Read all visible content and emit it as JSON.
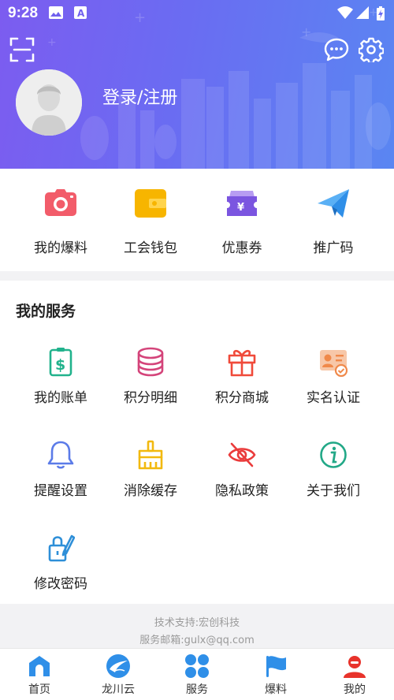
{
  "status_bar": {
    "time": "9:28"
  },
  "header": {
    "login_label": "登录/注册",
    "scan_icon": "scan-icon",
    "message_icon": "chat-bubble-icon",
    "settings_icon": "gear-icon"
  },
  "quick_actions": [
    {
      "label": "我的爆料",
      "icon": "camera-icon",
      "color": "#f25c6a"
    },
    {
      "label": "工会钱包",
      "icon": "wallet-icon",
      "color": "#f7b500"
    },
    {
      "label": "优惠券",
      "icon": "coupon-icon",
      "color": "#7b55e0"
    },
    {
      "label": "推广码",
      "icon": "paper-plane-icon",
      "color": "#2f8fe8"
    }
  ],
  "services": {
    "title": "我的服务",
    "items": [
      {
        "label": "我的账单",
        "icon": "bill-icon",
        "color": "#21b28c"
      },
      {
        "label": "积分明细",
        "icon": "coins-stack-icon",
        "color": "#d4447a"
      },
      {
        "label": "积分商城",
        "icon": "gift-icon",
        "color": "#f04a3a"
      },
      {
        "label": "实名认证",
        "icon": "id-card-icon",
        "color": "#f0894a"
      },
      {
        "label": "提醒设置",
        "icon": "bell-icon",
        "color": "#5b7be8"
      },
      {
        "label": "消除缓存",
        "icon": "broom-icon",
        "color": "#f2b90f"
      },
      {
        "label": "隐私政策",
        "icon": "eye-off-icon",
        "color": "#ea3b3b"
      },
      {
        "label": "关于我们",
        "icon": "info-icon",
        "color": "#22a887"
      },
      {
        "label": "修改密码",
        "icon": "lock-edit-icon",
        "color": "#2e8fd8"
      }
    ]
  },
  "support": {
    "tech": "技术支持:宏创科技",
    "email": "服务邮箱:gulx@qq.com"
  },
  "tabbar": [
    {
      "label": "首页",
      "icon": "home-icon"
    },
    {
      "label": "龙川云",
      "icon": "cloud-logo-icon"
    },
    {
      "label": "服务",
      "icon": "grid-petals-icon"
    },
    {
      "label": "爆料",
      "icon": "flag-icon"
    },
    {
      "label": "我的",
      "icon": "user-icon"
    }
  ]
}
